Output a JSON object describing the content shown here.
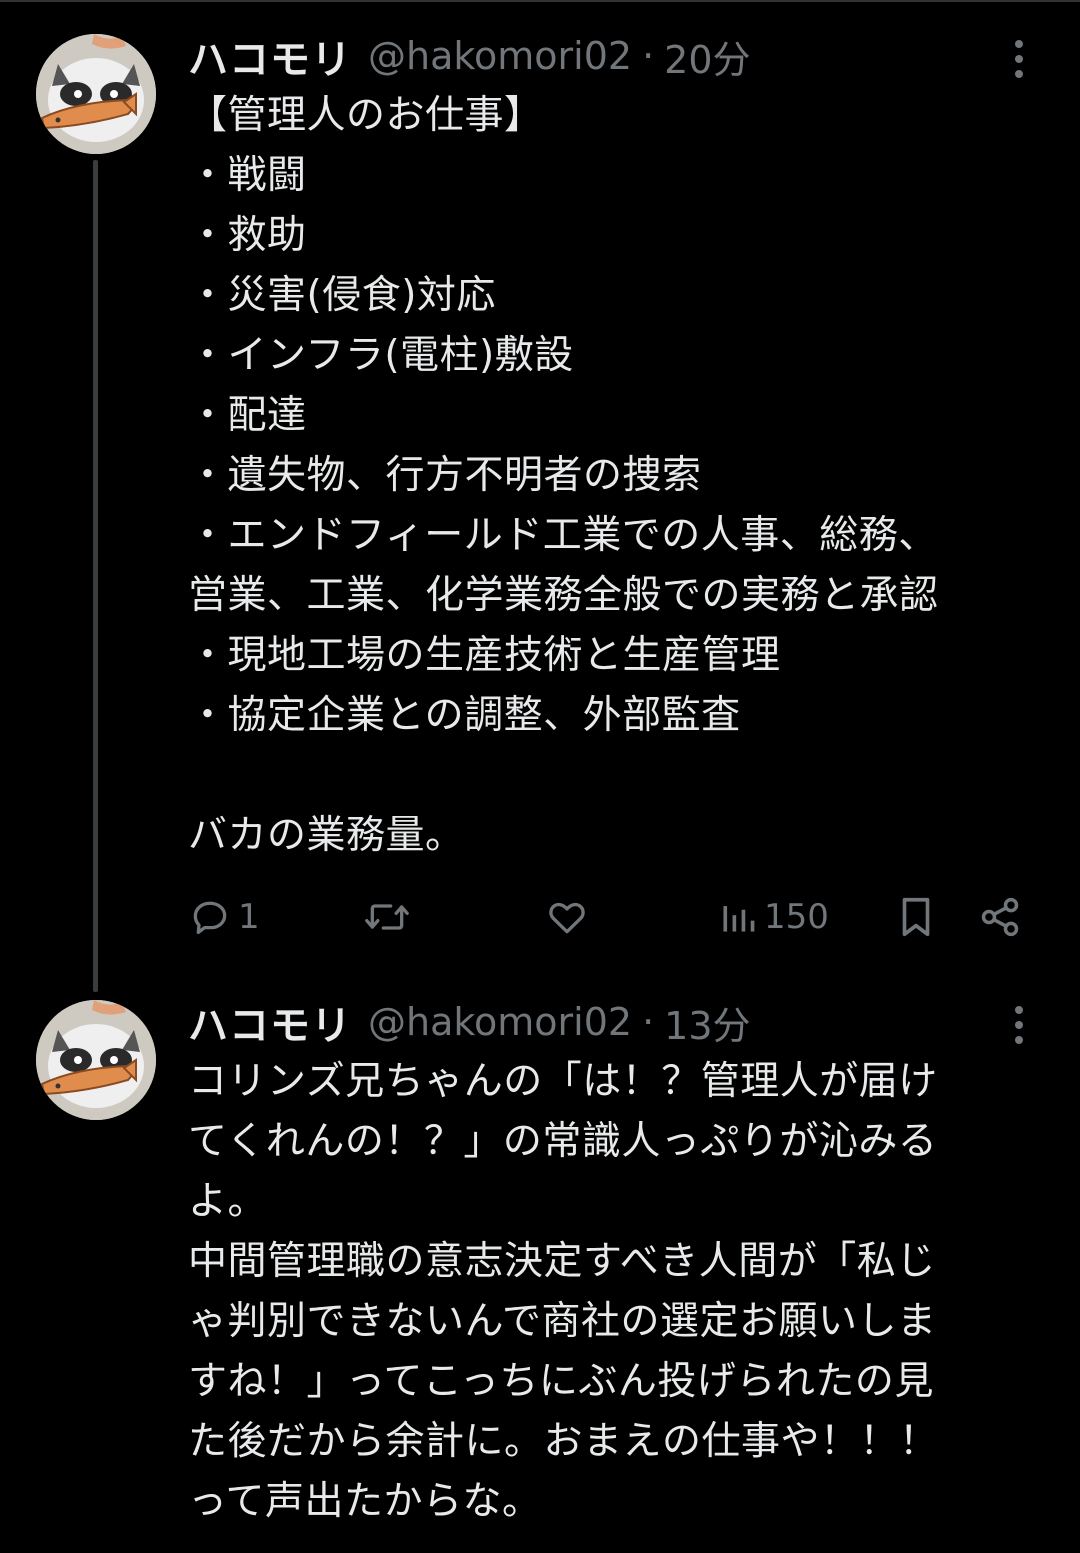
{
  "colors": {
    "background": "#000000",
    "text": "#e7e9ea",
    "muted": "#71767b",
    "thread_line": "#3a3d40"
  },
  "tweets": [
    {
      "display_name": "ハコモリ",
      "handle": "@hakomori02",
      "separator": "·",
      "time": "20分",
      "text": "【管理人のお仕事】\n・戦闘\n・救助\n・災害(侵食)対応\n・インフラ(電柱)敷設\n・配達\n・遺失物、行方不明者の捜索\n・エンドフィールド工業での人事、総務、\n営業、工業、化学業務全般での実務と承認\n・現地工場の生産技術と生産管理\n・協定企業との調整、外部監査\n\nバカの業務量。",
      "actions": {
        "reply_icon": "reply-icon",
        "reply_count": "1",
        "repost_icon": "repost-icon",
        "like_icon": "like-icon",
        "views_icon": "views-icon",
        "views_count": "150",
        "bookmark_icon": "bookmark-icon",
        "share_icon": "share-icon"
      }
    },
    {
      "display_name": "ハコモリ",
      "handle": "@hakomori02",
      "separator": "·",
      "time": "13分",
      "text": "コリンズ兄ちゃんの「は！？管理人が届け\nてくれんの！？」の常識人っぷりが沁みる\nよ。\n中間管理職の意志決定すべき人間が「私じ\nゃ判別できないんで商社の選定お願いしま\nすね！」ってこっちにぶん投げられたの見\nた後だから余計に。おまえの仕事や！！！\nって声出たからな。"
    }
  ]
}
